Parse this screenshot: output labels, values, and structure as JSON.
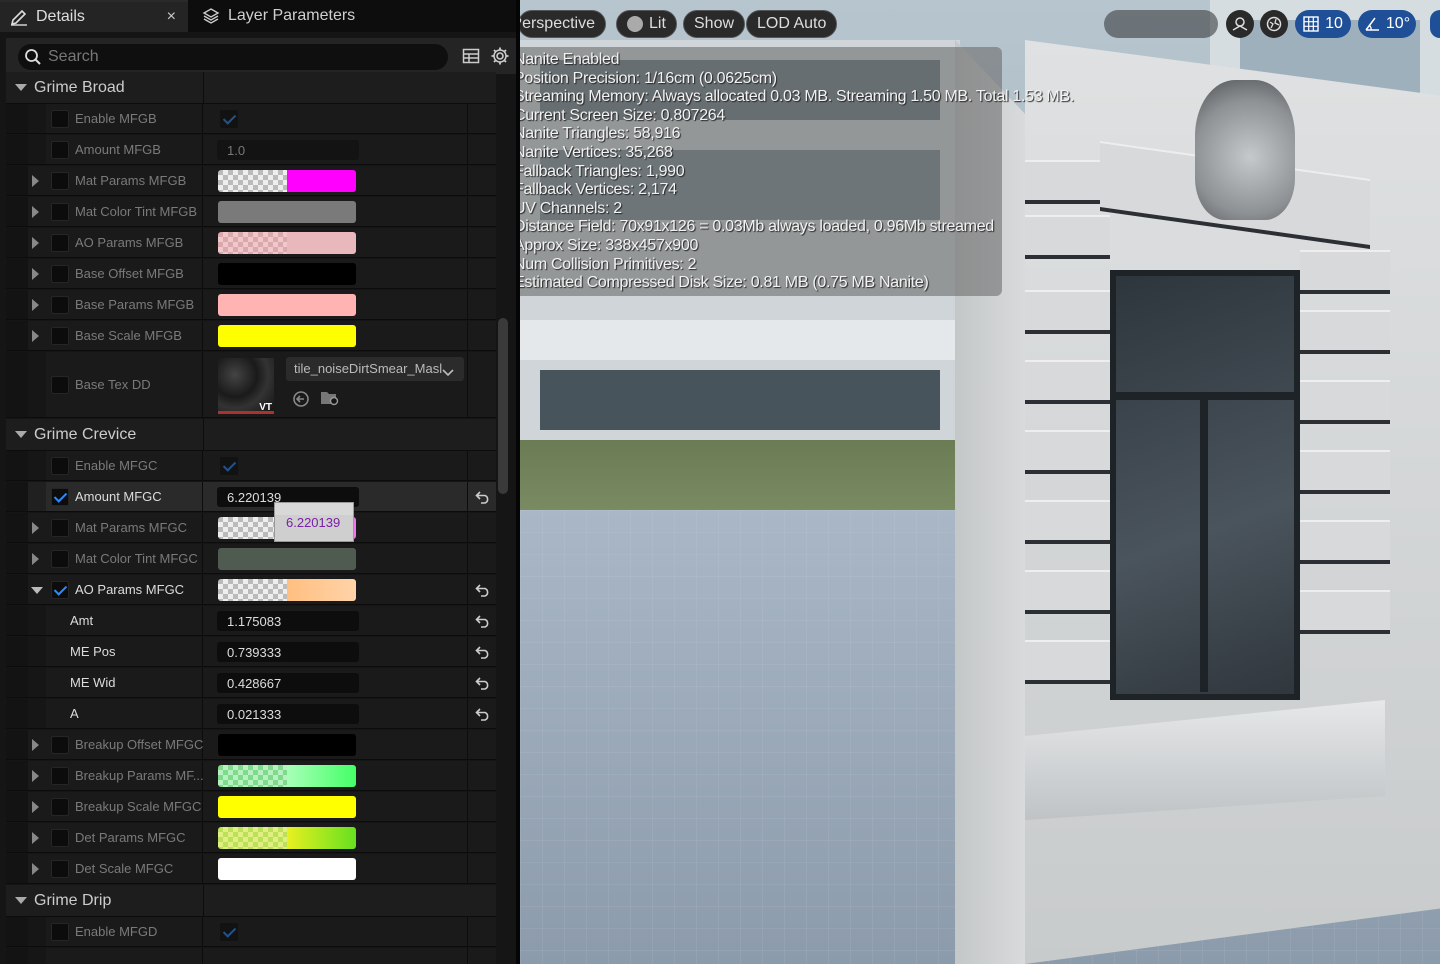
{
  "tabs": {
    "details": {
      "label": "Details",
      "close": "×"
    },
    "layer_params": {
      "label": "Layer Parameters"
    }
  },
  "search": {
    "placeholder": "Search"
  },
  "categories": [
    {
      "name": "Grime Broad"
    },
    {
      "name": "Grime Crevice"
    },
    {
      "name": "Grime Drip"
    }
  ],
  "grime_broad": {
    "enable": {
      "label": "Enable MFGB",
      "checked": true
    },
    "amount": {
      "label": "Amount MFGB",
      "value": "1.0"
    },
    "mat_params": {
      "label": "Mat Params MFGB",
      "color": "#ff00ff"
    },
    "mat_color_tint": {
      "label": "Mat Color Tint MFGB",
      "color": "#7a7a7a"
    },
    "ao_params": {
      "label": "AO Params MFGB",
      "color": "#e8b8bc"
    },
    "base_offset": {
      "label": "Base Offset MFGB",
      "color": "#000000"
    },
    "base_params": {
      "label": "Base Params MFGB",
      "color": "#ffb3b3"
    },
    "base_scale": {
      "label": "Base Scale MFGB",
      "color": "#ffff00"
    },
    "base_tex": {
      "label": "Base Tex DD",
      "texture": "tile_noiseDirtSmear_Masl",
      "badge": "VT"
    }
  },
  "grime_crevice": {
    "enable": {
      "label": "Enable MFGC",
      "checked": true
    },
    "amount": {
      "label": "Amount MFGC",
      "value": "6.220139",
      "tooltip": "6.220139"
    },
    "mat_params": {
      "label": "Mat Params MFGC",
      "color": "#ee77ee"
    },
    "mat_color_tint": {
      "label": "Mat Color Tint MFGC",
      "color": "#4f5a50"
    },
    "ao_params": {
      "label": "AO Params MFGC",
      "color": "#ffc98f"
    },
    "ao_sub": [
      {
        "label": "Amt",
        "value": "1.175083"
      },
      {
        "label": "ME Pos",
        "value": "0.739333"
      },
      {
        "label": "ME Wid",
        "value": "0.428667"
      },
      {
        "label": "A",
        "value": "0.021333"
      }
    ],
    "breakup_offset": {
      "label": "Breakup Offset MFGC",
      "color": "#000000"
    },
    "breakup_params": {
      "label": "Breakup Params MF...",
      "color": "#55ff77"
    },
    "breakup_scale": {
      "label": "Breakup Scale MFGC",
      "color": "#ffff00"
    },
    "det_params": {
      "label": "Det Params MFGC",
      "color": "#a8e030"
    },
    "det_scale": {
      "label": "Det Scale MFGC",
      "color": "#ffffff"
    }
  },
  "grime_drip": {
    "enable": {
      "label": "Enable MFGD",
      "checked": true
    }
  },
  "viewport": {
    "perspective": "Perspective",
    "lit": "Lit",
    "show": "Show",
    "lod": "LOD Auto",
    "grid_value": "10",
    "angle_value": "10°",
    "stats": [
      "Nanite Enabled",
      "Position Precision: 1/16cm (0.0625cm)",
      "Streaming Memory: Always allocated 0.03 MB. Streaming 1.50 MB. Total 1.53 MB.",
      "Current Screen Size: 0.807264",
      "Nanite Triangles: 58,916",
      "Nanite Vertices: 35,268",
      "Fallback Triangles: 1,990",
      "Fallback Vertices: 2,174",
      "UV Channels: 2",
      "Distance Field: 70x91x126 = 0.03Mb always loaded, 0.96Mb streamed",
      "Approx Size: 338x457x900",
      "Num Collision Primitives: 2",
      "Estimated Compressed Disk Size: 0.81 MB (0.75 MB Nanite)"
    ]
  }
}
